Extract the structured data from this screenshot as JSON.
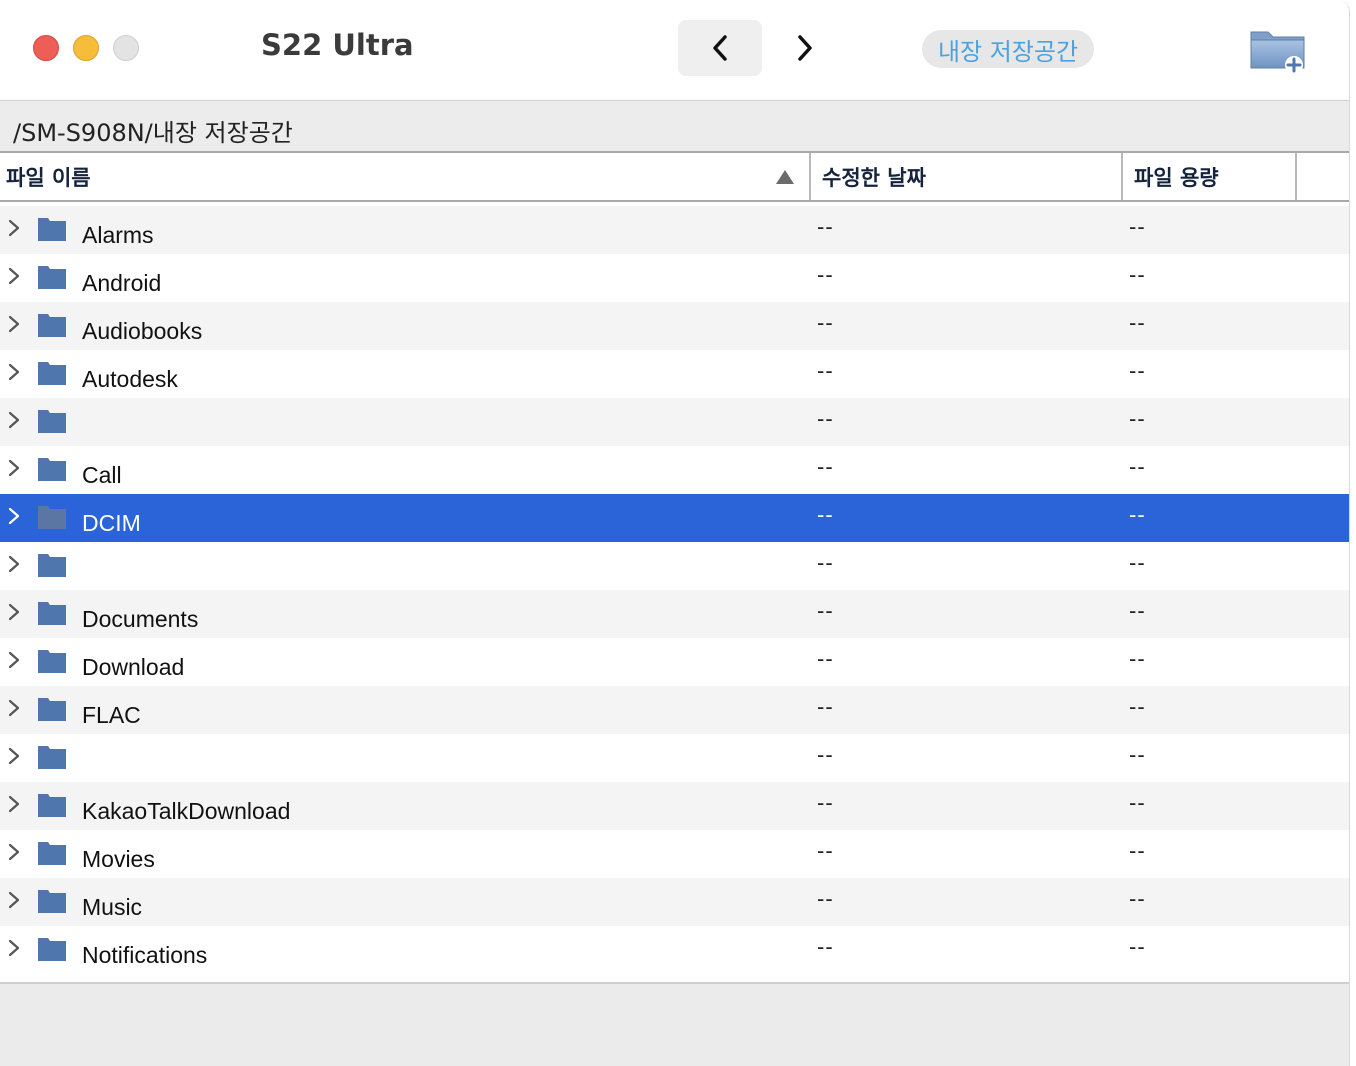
{
  "window": {
    "device_title": "S22 Ultra",
    "storage_button": "내장 저장공간",
    "path": "/SM-S908N/내장 저장공간"
  },
  "toolbar": {
    "back_icon": "chevron-left-icon",
    "forward_icon": "chevron-right-icon",
    "new_folder_icon": "new-folder-icon"
  },
  "columns": {
    "name": "파일 이름",
    "date": "수정한 날짜",
    "size": "파일 용량"
  },
  "rows": [
    {
      "name": "Alarms",
      "date": "--",
      "size": "--"
    },
    {
      "name": "Android",
      "date": "--",
      "size": "--"
    },
    {
      "name": "Audiobooks",
      "date": "--",
      "size": "--"
    },
    {
      "name": "Autodesk",
      "date": "--",
      "size": "--"
    },
    {
      "name": "",
      "date": "--",
      "size": "--"
    },
    {
      "name": "Call",
      "date": "--",
      "size": "--"
    },
    {
      "name": "DCIM",
      "date": "--",
      "size": "--",
      "selected": true
    },
    {
      "name": "",
      "date": "--",
      "size": "--"
    },
    {
      "name": "Documents",
      "date": "--",
      "size": "--"
    },
    {
      "name": "Download",
      "date": "--",
      "size": "--"
    },
    {
      "name": "FLAC",
      "date": "--",
      "size": "--"
    },
    {
      "name": "",
      "date": "--",
      "size": "--"
    },
    {
      "name": "KakaoTalkDownload",
      "date": "--",
      "size": "--"
    },
    {
      "name": "Movies",
      "date": "--",
      "size": "--"
    },
    {
      "name": "Music",
      "date": "--",
      "size": "--"
    },
    {
      "name": "Notifications",
      "date": "--",
      "size": "--"
    }
  ],
  "colors": {
    "selection": "#2b63d9",
    "folder": "#4f77ad",
    "storage_text": "#4aa3e0"
  }
}
